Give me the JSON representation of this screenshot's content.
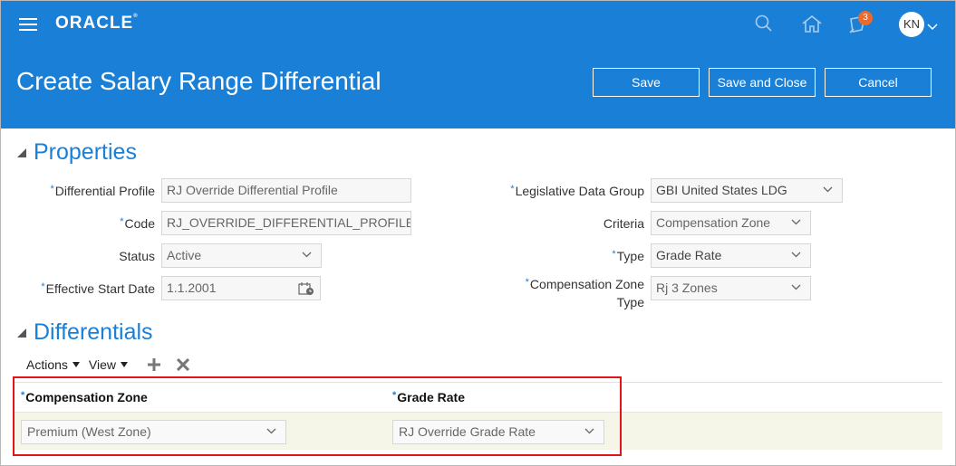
{
  "app": {
    "logo": "ORACLE",
    "notification_count": "3",
    "user_initials": "KN"
  },
  "header": {
    "title": "Create Salary Range Differential",
    "save_label": "Save",
    "save_close_label": "Save and Close",
    "cancel_label": "Cancel"
  },
  "properties": {
    "section_title": "Properties",
    "differential_profile": {
      "label": "Differential Profile",
      "value": "RJ Override Differential Profile"
    },
    "code": {
      "label": "Code",
      "value": "RJ_OVERRIDE_DIFFERENTIAL_PROFILE"
    },
    "status": {
      "label": "Status",
      "value": "Active"
    },
    "effective_start_date": {
      "label": "Effective Start Date",
      "value": "1.1.2001"
    },
    "legislative_data_group": {
      "label": "Legislative Data Group",
      "value": "GBI United States LDG"
    },
    "criteria": {
      "label": "Criteria",
      "value": "Compensation Zone"
    },
    "type": {
      "label": "Type",
      "value": "Grade Rate"
    },
    "compensation_zone_type": {
      "label_line1": "Compensation Zone",
      "label_line2": "Type",
      "value": "Rj 3 Zones"
    }
  },
  "differentials": {
    "section_title": "Differentials",
    "actions_label": "Actions",
    "view_label": "View",
    "columns": [
      "Compensation Zone",
      "Grade Rate"
    ],
    "rows": [
      {
        "compensation_zone": "Premium (West Zone)",
        "grade_rate": "RJ Override Grade Rate"
      }
    ]
  },
  "colors": {
    "brand_blue": "#1a7fd6",
    "highlight_red": "#e0151b",
    "badge_orange": "#ec6a2c"
  }
}
